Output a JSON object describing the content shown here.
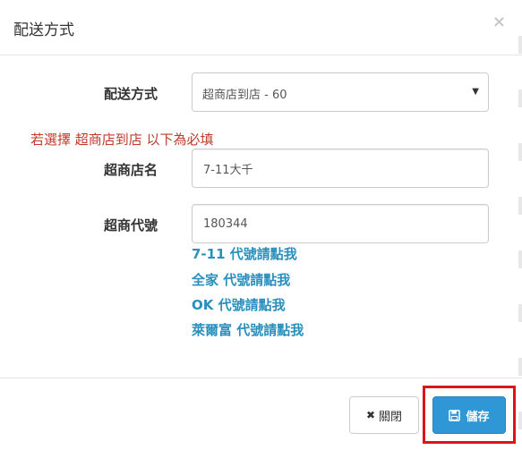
{
  "header": {
    "title": "配送方式",
    "close_glyph": "×"
  },
  "form": {
    "shipping_label": "配送方式",
    "shipping_selected": "超商店到店 - 60",
    "warning": "若選擇 超商店到店 以下為必填",
    "store_name_label": "超商店名",
    "store_name_value": "7-11大千",
    "store_code_label": "超商代號",
    "store_code_value": "180344"
  },
  "links": [
    {
      "prefix": "7-11",
      "label": " 代號請點我"
    },
    {
      "prefix": "全家",
      "label": " 代號請點我"
    },
    {
      "prefix": "OK",
      "label": " 代號請點我"
    },
    {
      "prefix": "萊爾富",
      "label": " 代號請點我"
    }
  ],
  "footer": {
    "close_label": "關閉",
    "save_label": "儲存"
  },
  "colors": {
    "primary": "#2f97d6",
    "warning": "#c0392b",
    "link": "#2a8fbd",
    "highlight": "#d9161b"
  }
}
